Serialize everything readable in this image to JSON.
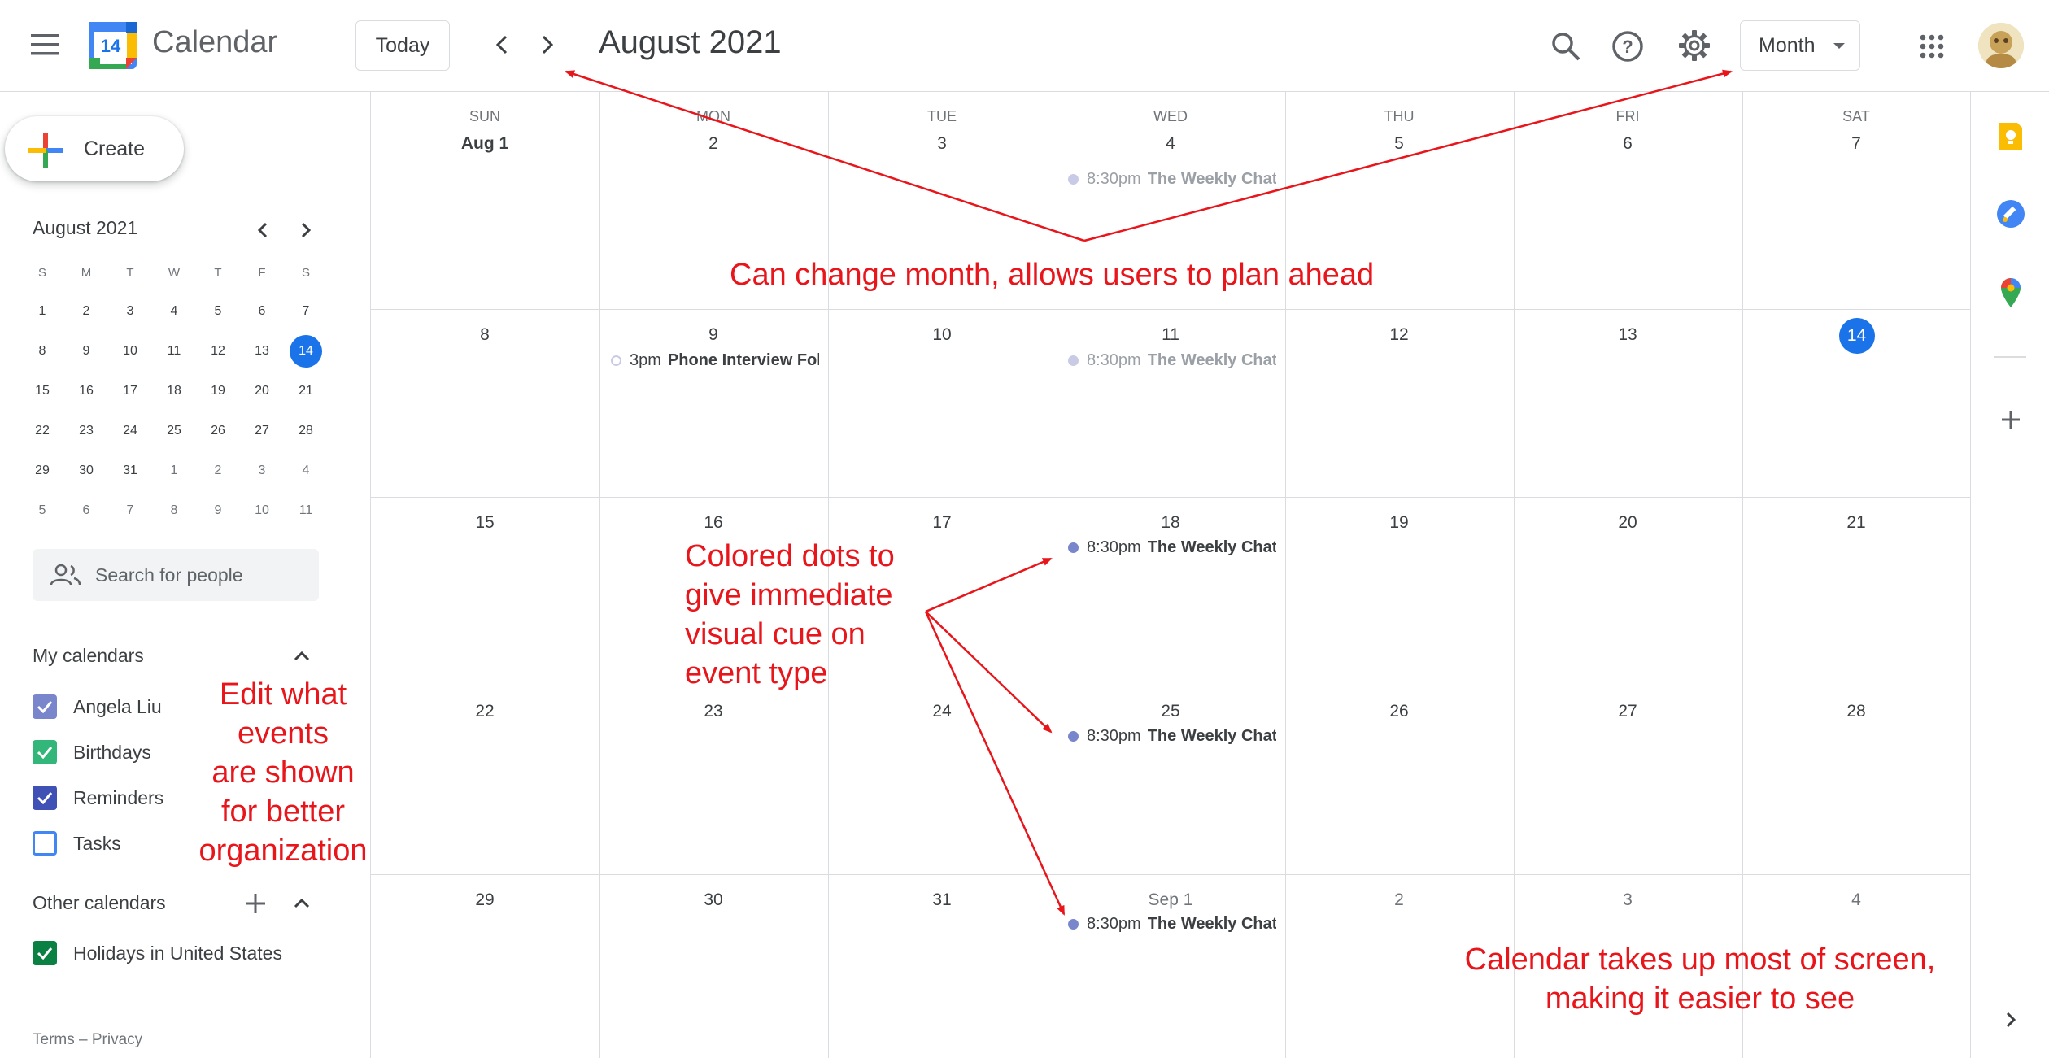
{
  "header": {
    "app_name": "Calendar",
    "logo_day": "14",
    "today_label": "Today",
    "month_title": "August 2021",
    "view_label": "Month"
  },
  "sidebar": {
    "create_label": "Create",
    "mini_calendar": {
      "title": "August 2021",
      "weekdays": [
        "S",
        "M",
        "T",
        "W",
        "T",
        "F",
        "S"
      ],
      "weeks": [
        [
          "1",
          "2",
          "3",
          "4",
          "5",
          "6",
          "7"
        ],
        [
          "8",
          "9",
          "10",
          "11",
          "12",
          "13",
          "14"
        ],
        [
          "15",
          "16",
          "17",
          "18",
          "19",
          "20",
          "21"
        ],
        [
          "22",
          "23",
          "24",
          "25",
          "26",
          "27",
          "28"
        ],
        [
          "29",
          "30",
          "31",
          "1",
          "2",
          "3",
          "4"
        ],
        [
          "5",
          "6",
          "7",
          "8",
          "9",
          "10",
          "11"
        ]
      ],
      "today": "14"
    },
    "search_placeholder": "Search for people",
    "my_calendars_title": "My calendars",
    "my_calendars": [
      {
        "label": "Angela Liu",
        "color": "#7986cb",
        "checked": true
      },
      {
        "label": "Birthdays",
        "color": "#33b679",
        "checked": true
      },
      {
        "label": "Reminders",
        "color": "#3f51b5",
        "checked": true
      },
      {
        "label": "Tasks",
        "color": "#4285f4",
        "checked": false
      }
    ],
    "other_calendars_title": "Other calendars",
    "other_calendars": [
      {
        "label": "Holidays in United States",
        "color": "#0b8043",
        "checked": true
      }
    ],
    "footer": "Terms – Privacy"
  },
  "grid": {
    "weekdays": [
      "SUN",
      "MON",
      "TUE",
      "WED",
      "THU",
      "FRI",
      "SAT"
    ],
    "weeks": [
      [
        "Aug 1",
        "2",
        "3",
        "4",
        "5",
        "6",
        "7"
      ],
      [
        "8",
        "9",
        "10",
        "11",
        "12",
        "13",
        "14"
      ],
      [
        "15",
        "16",
        "17",
        "18",
        "19",
        "20",
        "21"
      ],
      [
        "22",
        "23",
        "24",
        "25",
        "26",
        "27",
        "28"
      ],
      [
        "29",
        "30",
        "31",
        "Sep 1",
        "2",
        "3",
        "4"
      ]
    ],
    "today": "14",
    "events": [
      {
        "week": 0,
        "day": 3,
        "time": "8:30pm",
        "title": "The Weekly Chat",
        "state": "past"
      },
      {
        "week": 1,
        "day": 1,
        "time": "3pm",
        "title": "Phone Interview Follow-up",
        "state": "hollow"
      },
      {
        "week": 1,
        "day": 3,
        "time": "8:30pm",
        "title": "The Weekly Chat",
        "state": "past"
      },
      {
        "week": 2,
        "day": 3,
        "time": "8:30pm",
        "title": "The Weekly Chat",
        "state": "cur"
      },
      {
        "week": 3,
        "day": 3,
        "time": "8:30pm",
        "title": "The Weekly Chat",
        "state": "cur"
      },
      {
        "week": 4,
        "day": 3,
        "time": "8:30pm",
        "title": "The Weekly Chat",
        "state": "cur"
      }
    ]
  },
  "annotations": {
    "change_month": "Can change month, allows users to plan ahead",
    "colored_dots": "Colored dots to give immediate visual cue on event type",
    "colored_dots_lines": [
      "Colored dots to",
      "give immediate",
      "visual cue on",
      "event type"
    ],
    "edit_events_lines": [
      "Edit what",
      "events",
      "are shown",
      "for better",
      "organization"
    ],
    "calendar_size_lines": [
      "Calendar takes up most of screen,",
      "making it easier to see"
    ]
  },
  "colors": {
    "accent": "#1a73e8",
    "annotation": "#e8151b",
    "event_dot": "#7986cb"
  }
}
